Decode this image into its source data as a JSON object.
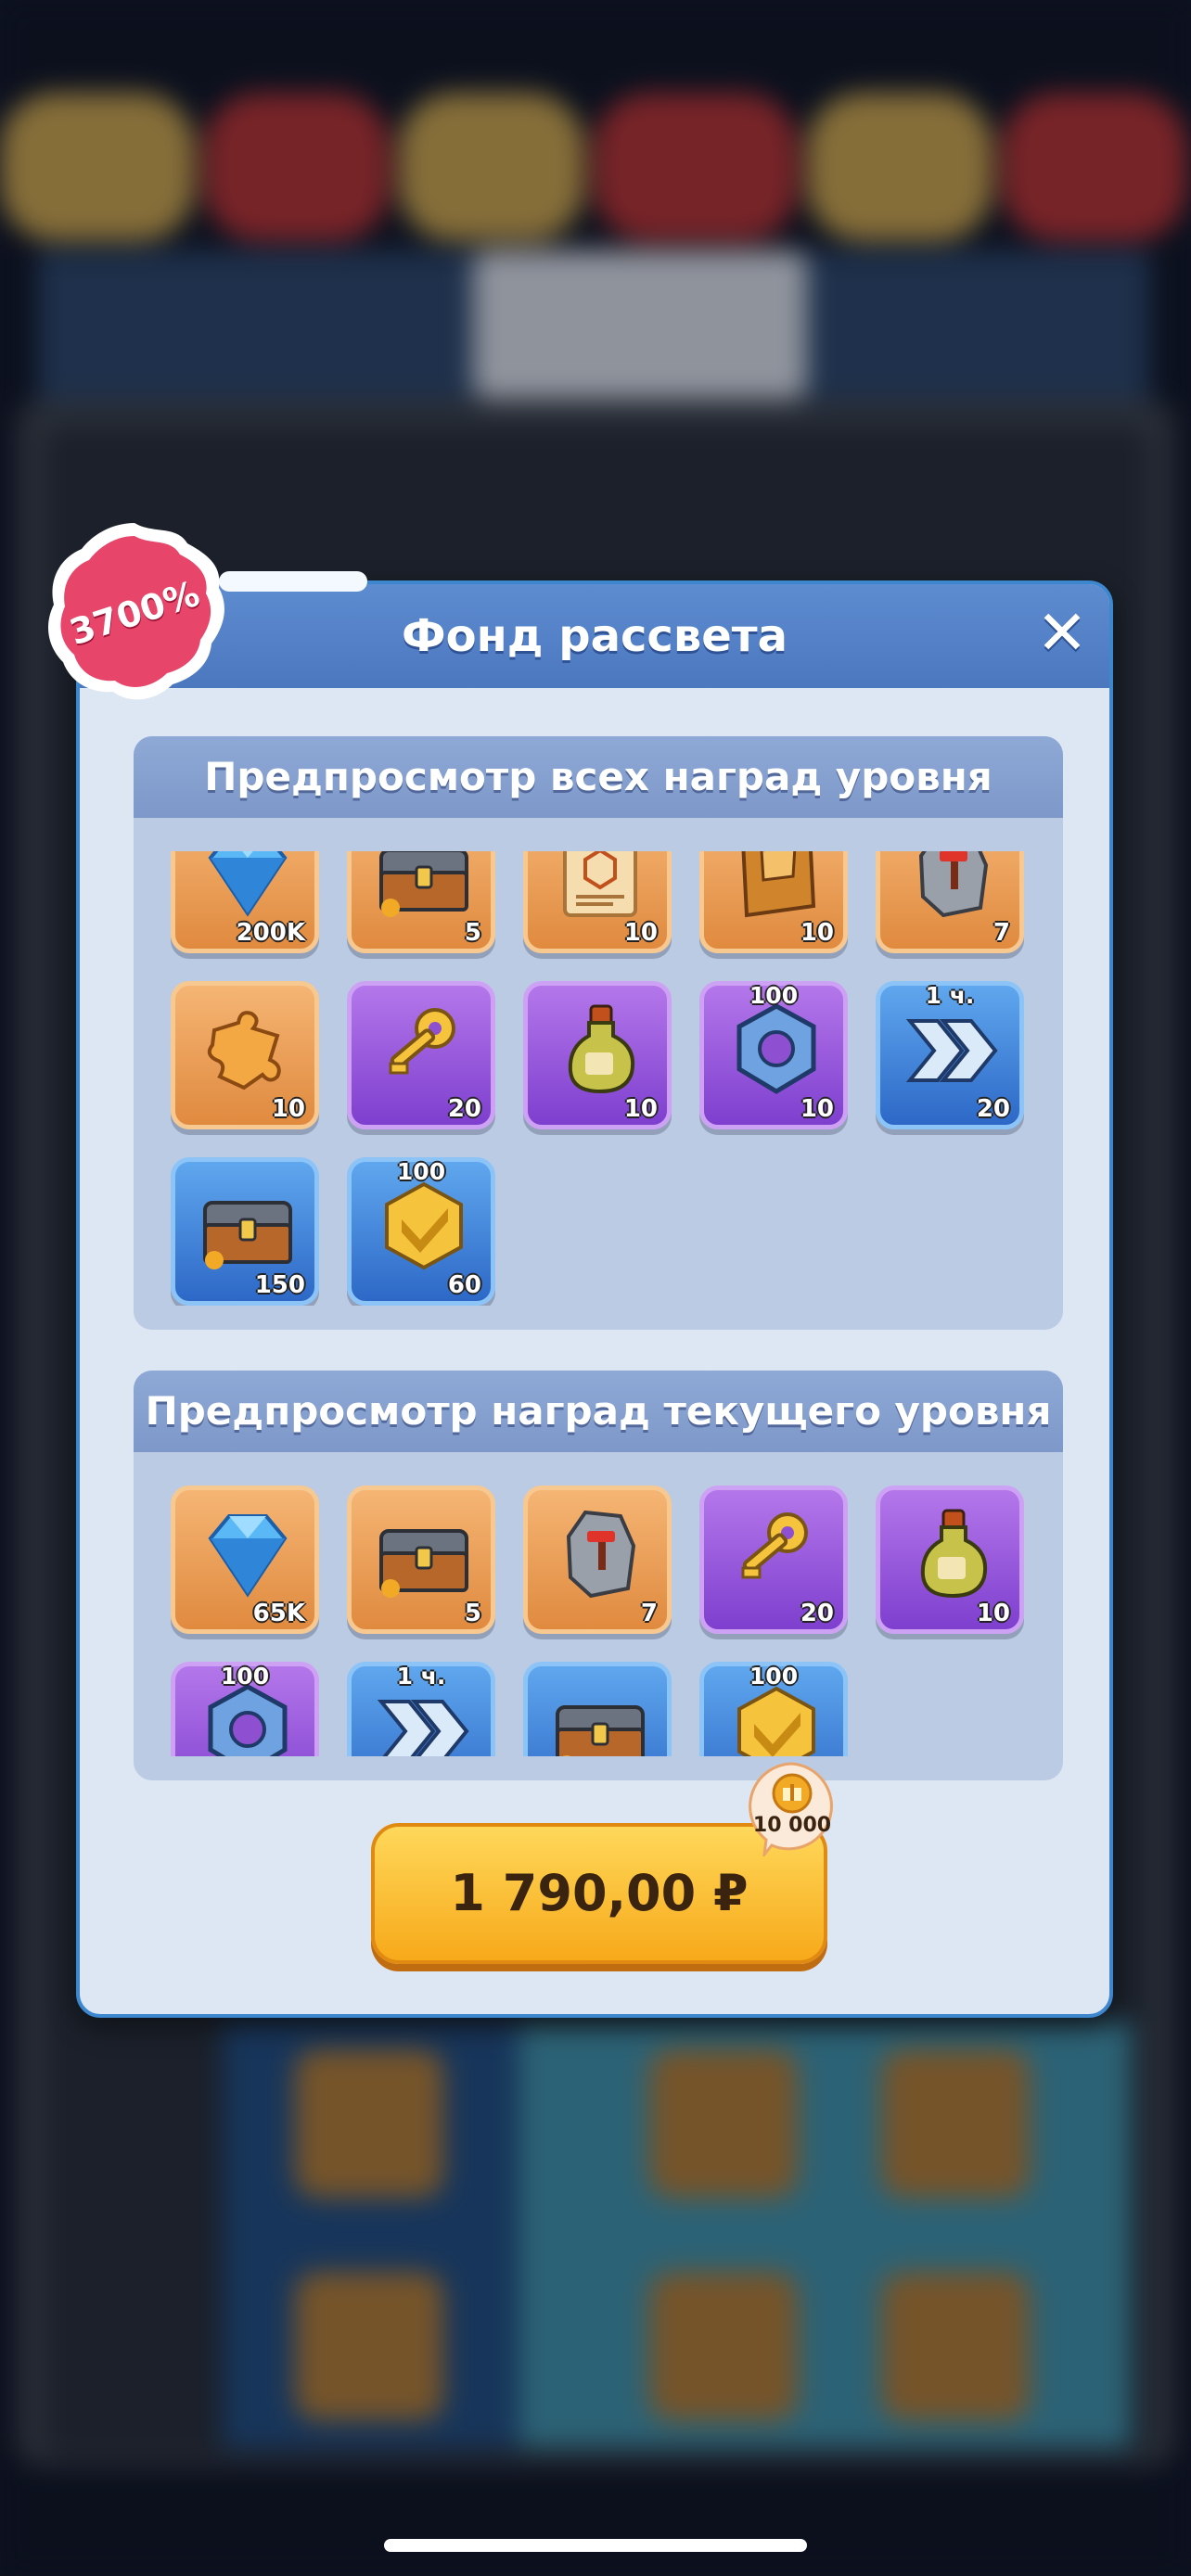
{
  "dialog": {
    "title": "Фонд рассвета",
    "close_icon": "close-icon",
    "discount_badge": "3700%"
  },
  "all_rewards": {
    "title": "Предпросмотр всех наград уровня",
    "items": [
      {
        "icon": "diamond-icon",
        "count": "200K",
        "rarity": "orange"
      },
      {
        "icon": "chest-icon",
        "count": "5",
        "rarity": "orange"
      },
      {
        "icon": "scroll-icon",
        "count": "10",
        "rarity": "orange"
      },
      {
        "icon": "book-icon",
        "count": "10",
        "rarity": "orange"
      },
      {
        "icon": "stone-icon",
        "count": "7",
        "rarity": "orange"
      },
      {
        "icon": "puzzle-icon",
        "count": "10",
        "rarity": "orange"
      },
      {
        "icon": "key-icon",
        "count": "20",
        "rarity": "purple"
      },
      {
        "icon": "potion-icon",
        "count": "10",
        "rarity": "purple"
      },
      {
        "icon": "nut-icon",
        "count": "10",
        "top": "100",
        "rarity": "purple"
      },
      {
        "icon": "speedup-icon",
        "count": "20",
        "top": "1 ч.",
        "rarity": "blue"
      },
      {
        "icon": "chest-icon",
        "count": "150",
        "rarity": "blue"
      },
      {
        "icon": "gold-gem-icon",
        "count": "60",
        "top": "100",
        "rarity": "blue"
      }
    ]
  },
  "current_rewards": {
    "title": "Предпросмотр наград текущего уровня",
    "items": [
      {
        "icon": "diamond-icon",
        "count": "65K",
        "rarity": "orange"
      },
      {
        "icon": "chest-icon",
        "count": "5",
        "rarity": "orange"
      },
      {
        "icon": "stone-icon",
        "count": "7",
        "rarity": "orange"
      },
      {
        "icon": "key-icon",
        "count": "20",
        "rarity": "purple"
      },
      {
        "icon": "potion-icon",
        "count": "10",
        "rarity": "purple"
      },
      {
        "icon": "nut-icon",
        "count": "",
        "top": "100",
        "rarity": "purple"
      },
      {
        "icon": "speedup-icon",
        "count": "",
        "top": "1 ч.",
        "rarity": "blue"
      },
      {
        "icon": "chest-icon",
        "count": "",
        "rarity": "blue"
      },
      {
        "icon": "gold-gem-icon",
        "count": "",
        "top": "100",
        "rarity": "blue"
      }
    ]
  },
  "purchase": {
    "price": "1 790,00 ₽",
    "bonus_points": "10 000",
    "bonus_icon": "gift-coin-icon"
  }
}
